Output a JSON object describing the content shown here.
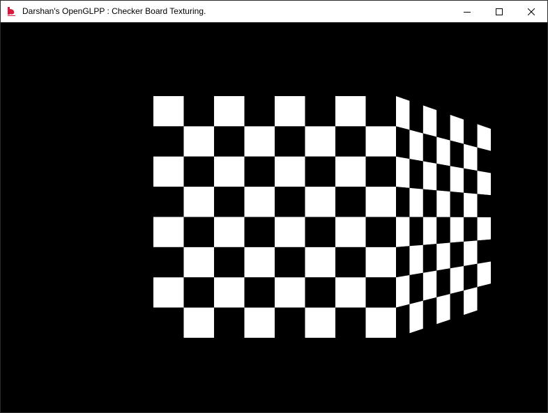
{
  "window": {
    "title": "Darshan's OpenGLPP : Checker Board Texturing.",
    "icon": "app-logo-icon",
    "controls": {
      "minimize": "minimize-icon",
      "maximize": "maximize-icon",
      "close": "close-icon"
    }
  },
  "scene": {
    "background_color": "#000000",
    "checker_colors": [
      "#ffffff",
      "#000000"
    ],
    "quads": [
      {
        "name": "front-facing-checkerboard",
        "rows": 8,
        "cols": 8
      },
      {
        "name": "tilted-checkerboard",
        "rows": 8,
        "cols": 7
      }
    ]
  }
}
